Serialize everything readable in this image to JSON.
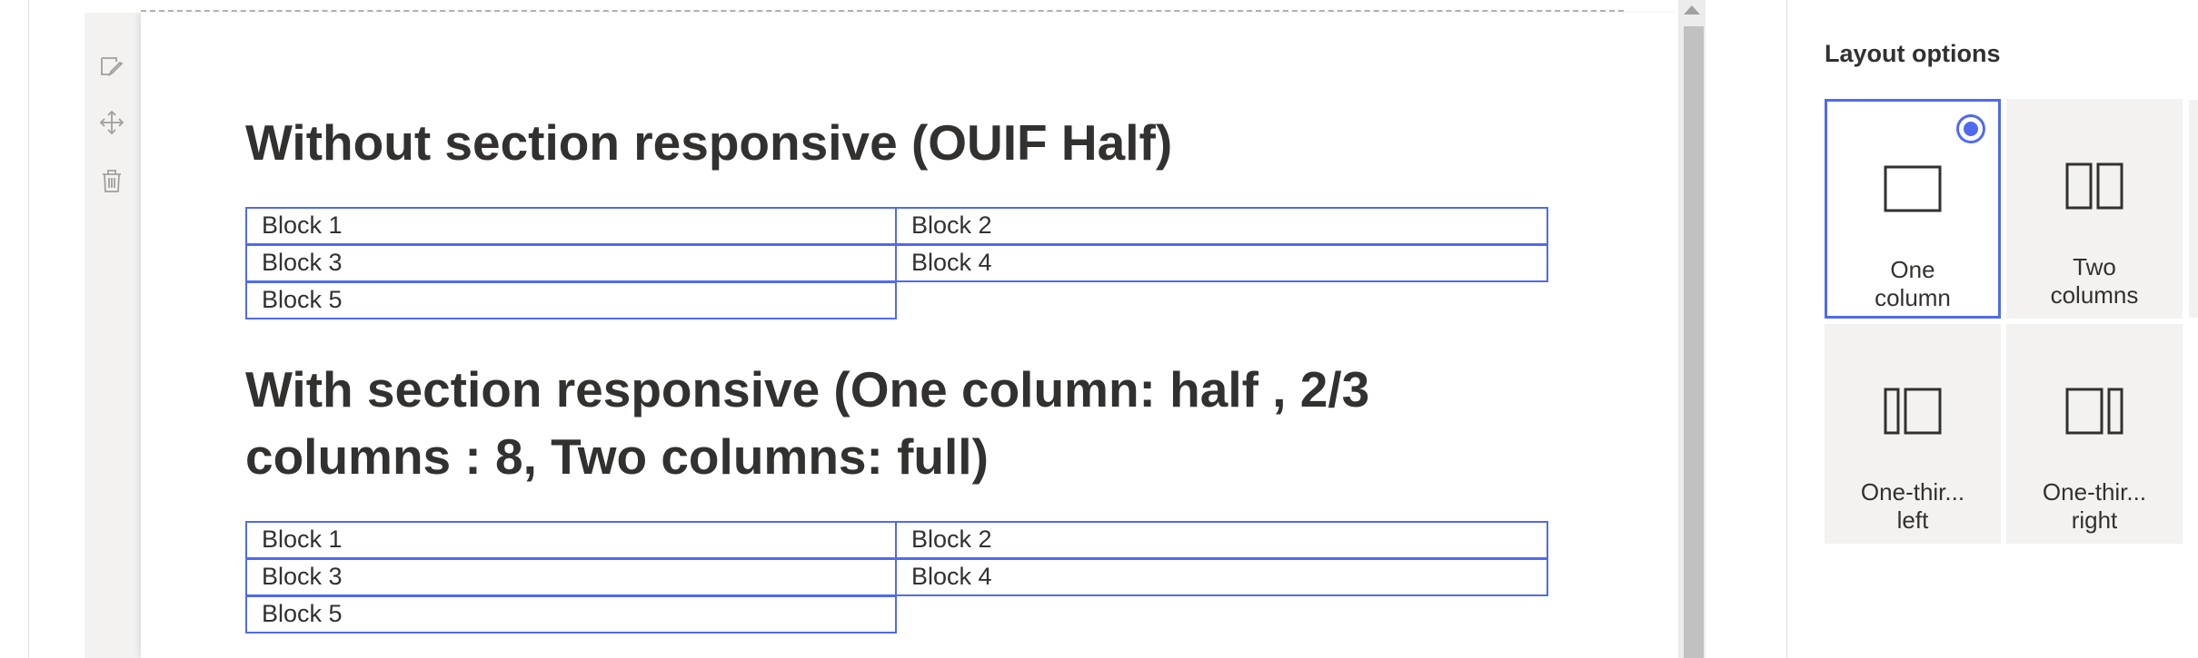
{
  "toolbar": {
    "items": [
      {
        "icon": "edit-icon",
        "label": "Edit section"
      },
      {
        "icon": "move-icon",
        "label": "Move section"
      },
      {
        "icon": "trash-icon",
        "label": "Delete section"
      }
    ]
  },
  "canvas": {
    "section1": {
      "heading": "Without section responsive (OUIF Half)",
      "blocks": [
        "Block 1",
        "Block 2",
        "Block 3",
        "Block 4",
        "Block 5"
      ]
    },
    "section2": {
      "heading_line1": "With section responsive (One column: half , 2/3",
      "heading_line2": "columns : 8, Two columns: full)",
      "blocks": [
        "Block 1",
        "Block 2",
        "Block 3",
        "Block 4",
        "Block 5"
      ]
    }
  },
  "panel": {
    "title": "Layout options",
    "options": [
      {
        "id": "one-column",
        "line1": "One",
        "line2": "column",
        "selected": true
      },
      {
        "id": "two-columns",
        "line1": "Two",
        "line2": "columns",
        "selected": false
      },
      {
        "id": "one-third-left",
        "line1": "One-thir...",
        "line2": "left",
        "selected": false
      },
      {
        "id": "one-third-right",
        "line1": "One-thir...",
        "line2": "right",
        "selected": false
      }
    ]
  },
  "colors": {
    "accent": "#4f6bed",
    "text": "#323130",
    "option_bg": "#f3f2f1",
    "toolbar_bg": "#f3f2f1"
  }
}
